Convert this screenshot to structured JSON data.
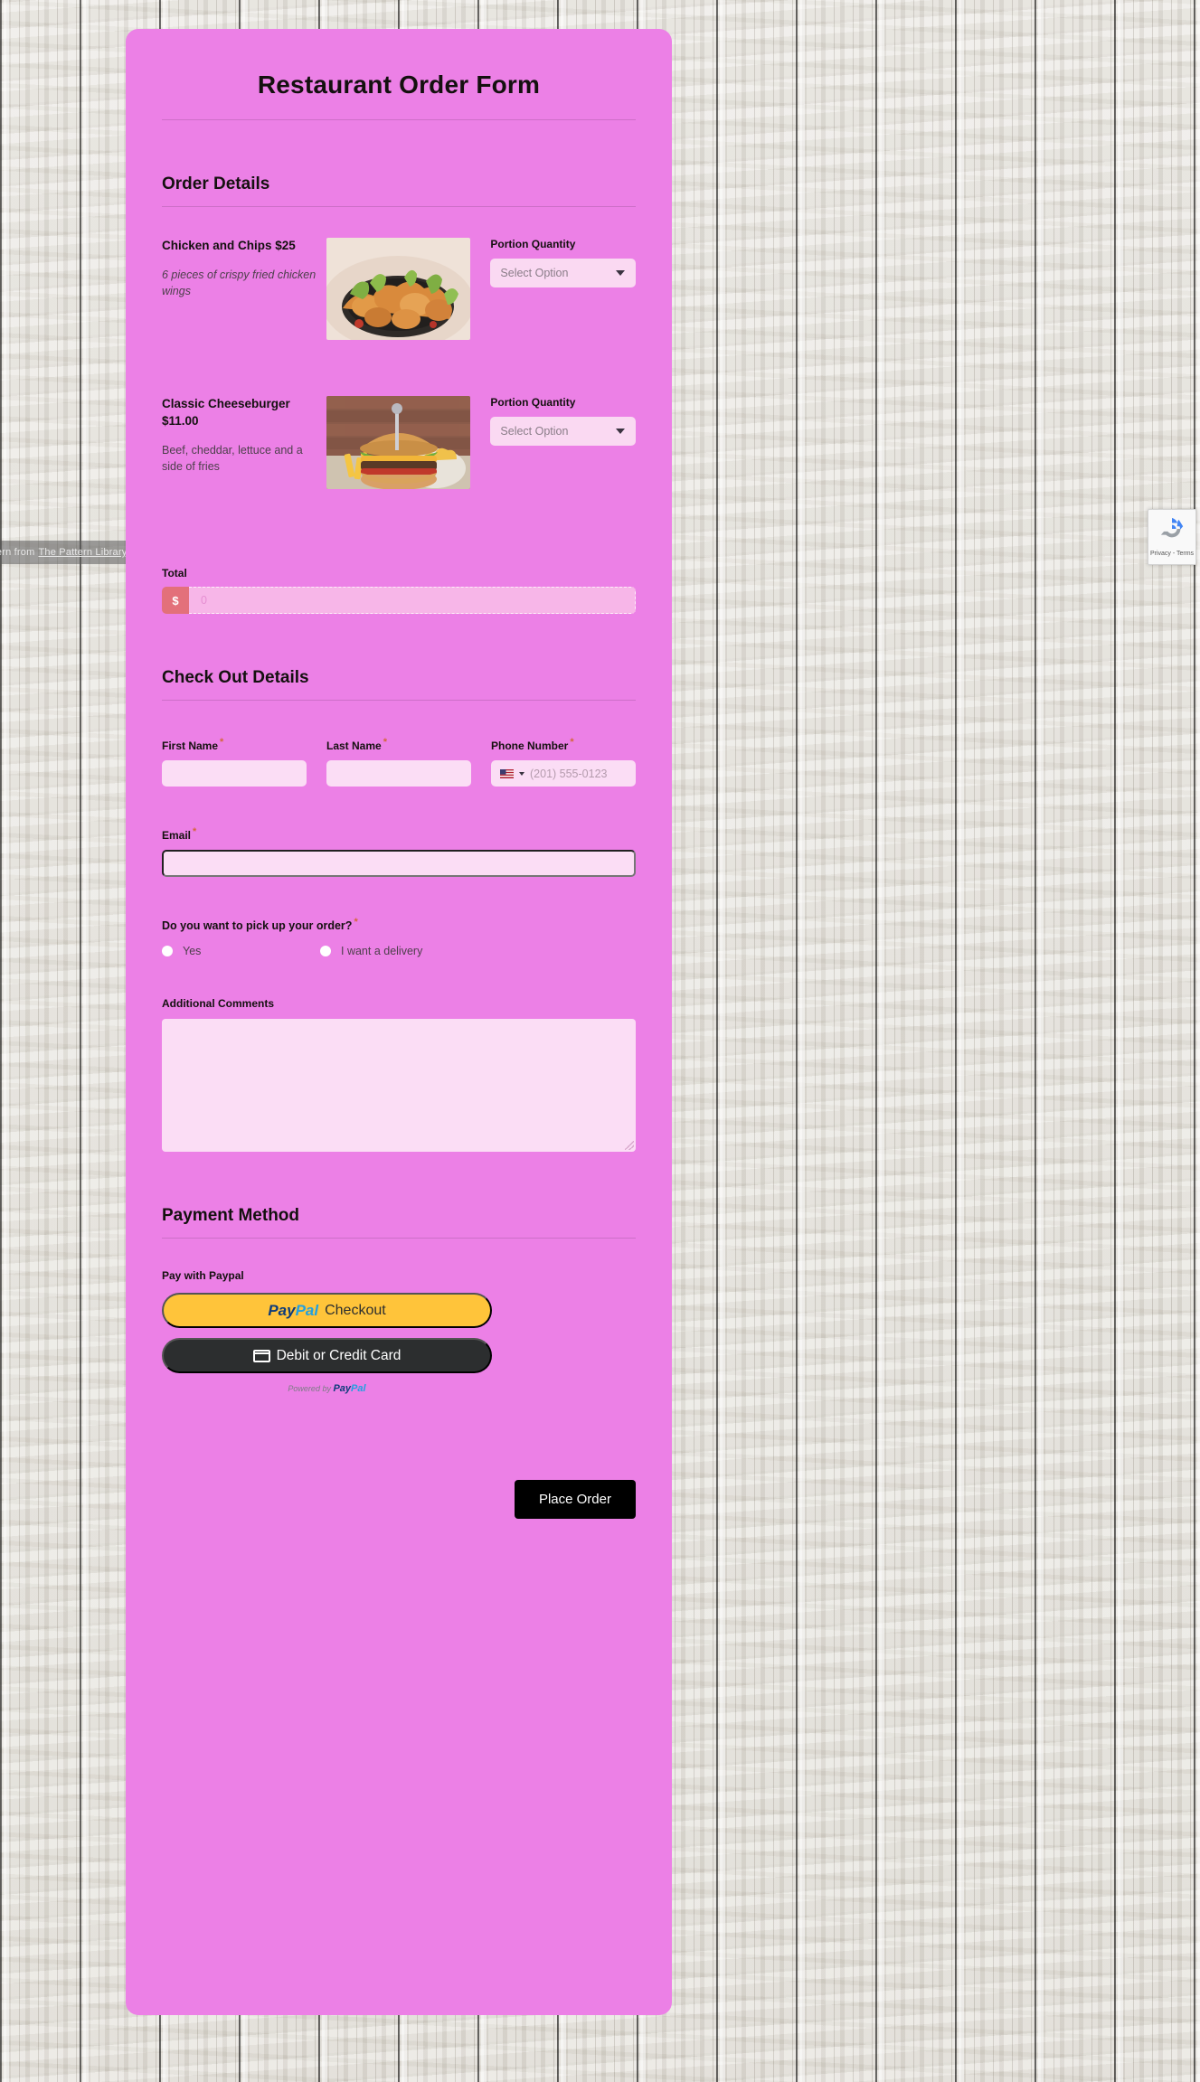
{
  "attribution": {
    "prefix": "Pattern from",
    "link": "The Pattern Library"
  },
  "recaptcha": {
    "terms": "Privacy - Terms",
    "icon": "recaptcha-icon"
  },
  "form": {
    "title": "Restaurant Order Form",
    "sections": {
      "order_details": "Order Details",
      "checkout_details": "Check Out Details",
      "payment_method": "Payment Method"
    },
    "items": [
      {
        "name": "Chicken and Chips $25",
        "description": "6 pieces of crispy fried chicken wings",
        "description_italic": true,
        "image_alt": "fried-chicken-photo",
        "quantity_label": "Portion Quantity",
        "quantity_value": "Select Option"
      },
      {
        "name": "Classic Cheeseburger $11.00",
        "description": "Beef, cheddar, lettuce and a side of fries",
        "description_italic": false,
        "image_alt": "cheeseburger-photo",
        "quantity_label": "Portion Quantity",
        "quantity_value": "Select Option"
      }
    ],
    "total": {
      "label": "Total",
      "currency_symbol": "$",
      "placeholder": "0"
    },
    "first_name": {
      "label": "First Name",
      "required": "*",
      "value": ""
    },
    "last_name": {
      "label": "Last Name",
      "required": "*",
      "value": ""
    },
    "phone": {
      "label": "Phone Number",
      "required": "*",
      "placeholder": "(201) 555-0123",
      "country": "US"
    },
    "email": {
      "label": "Email",
      "required": "*",
      "value": ""
    },
    "pickup": {
      "question": "Do you want to pick up your order?",
      "required": "*",
      "options": [
        {
          "label": "Yes",
          "selected": false
        },
        {
          "label": "I want a delivery",
          "selected": false
        }
      ]
    },
    "comments": {
      "label": "Additional Comments",
      "value": ""
    },
    "payment": {
      "subtitle": "Pay with Paypal",
      "paypal_word_pay": "Pay",
      "paypal_word_pal": "Pal",
      "checkout_label": "Checkout",
      "card_label": "Debit or Credit Card",
      "powered_prefix": "Powered by"
    },
    "submit": {
      "label": "Place Order"
    }
  },
  "colors": {
    "card_bg": "#ec80e6",
    "input_bg": "#fbddf5",
    "accent_red": "#e3707a",
    "paypal_yellow": "#ffc43a",
    "paypal_dark": "#2c2e2f",
    "required_star": "#d4663a"
  }
}
